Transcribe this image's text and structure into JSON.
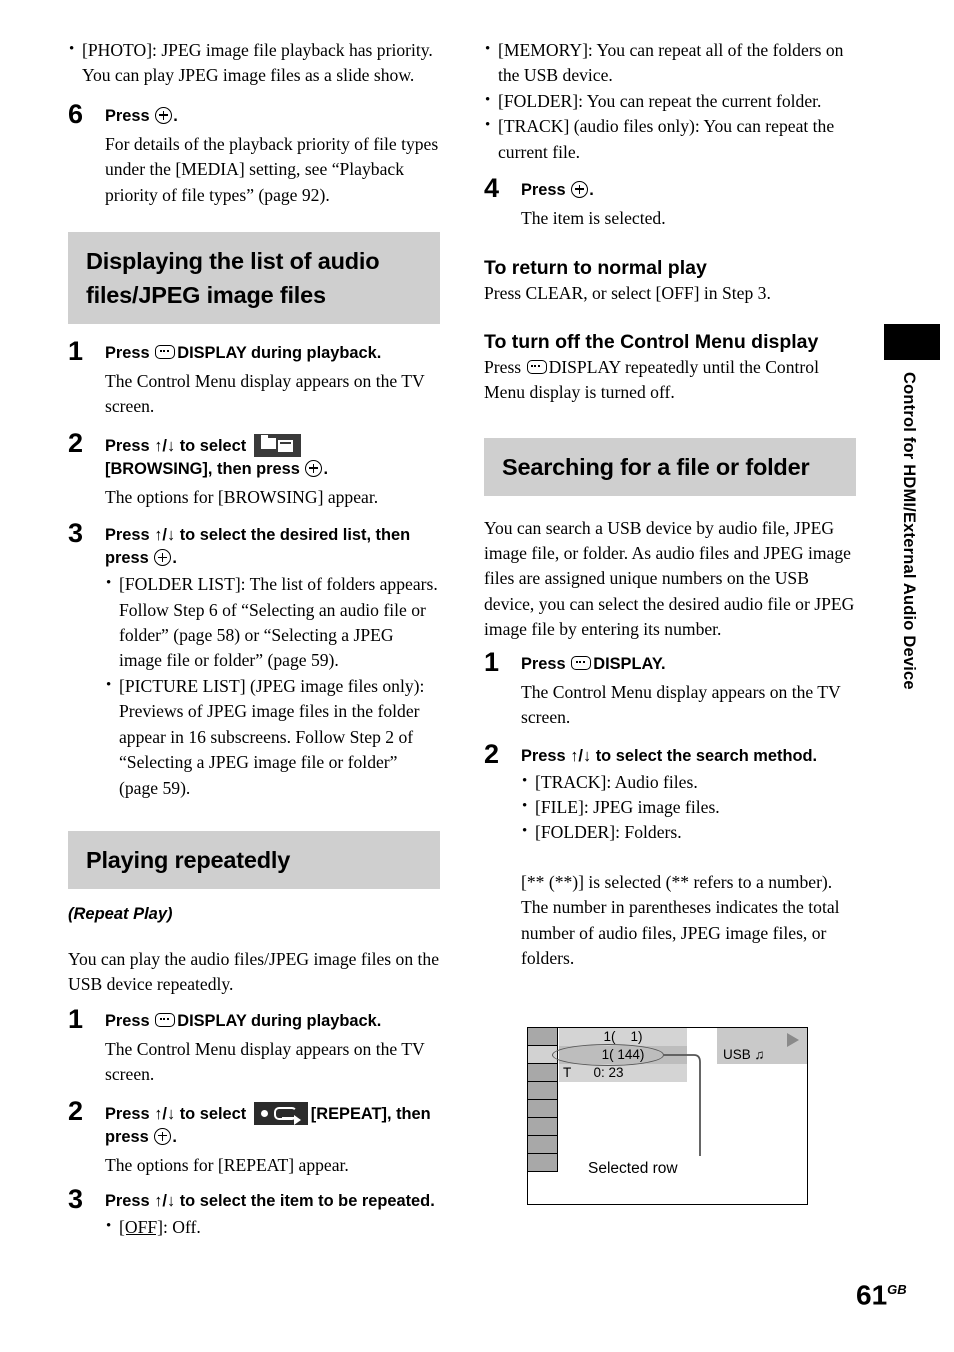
{
  "page": {
    "number": "61",
    "number_suffix": "GB",
    "side_tab_label": "Control for HDMI/External Audio Device"
  },
  "left_column": {
    "top_bullets": [
      "[PHOTO]: JPEG image file playback has priority. You can play JPEG image files as a slide show."
    ],
    "step6": {
      "num": "6",
      "title_pre": "Press",
      "title_post": ".",
      "body": "For details of the playback priority of file types under the [MEDIA] setting, see “Playback priority of file types” (page 92)."
    },
    "section1": {
      "heading": "Displaying the list of audio files/JPEG image files",
      "step1": {
        "num": "1",
        "title_pre": "Press",
        "title_post": "DISPLAY during playback.",
        "body": "The Control Menu display appears on the TV screen."
      },
      "step2": {
        "num": "2",
        "title_pre": "Press ↑/↓ to select",
        "title_mid": "[BROWSING], then press",
        "title_post": ".",
        "body": "The options for [BROWSING] appear."
      },
      "step3": {
        "num": "3",
        "title_pre": "Press ↑/↓ to select the desired list, then press",
        "title_post": ".",
        "bullets": [
          "[FOLDER LIST]: The list of folders appears. Follow Step 6 of “Selecting an audio file or folder” (page 58) or “Selecting a JPEG image file or folder” (page 59).",
          "[PICTURE LIST] (JPEG image files only): Previews of JPEG image files in the folder appear in 16 subscreens. Follow Step 2 of “Selecting a JPEG image file or folder” (page 59)."
        ]
      }
    },
    "section2": {
      "heading": "Playing repeatedly",
      "subtitle": "(Repeat Play)",
      "intro": "You can play the audio files/JPEG image files on the USB device repeatedly.",
      "step1": {
        "num": "1",
        "title_pre": "Press",
        "title_post": "DISPLAY during playback.",
        "body": "The Control Menu display appears on the TV screen."
      },
      "step2": {
        "num": "2",
        "title_pre": "Press ↑/↓ to select",
        "title_mid": "[REPEAT], then press",
        "title_post": ".",
        "body": "The options for [REPEAT] appear."
      },
      "step3": {
        "num": "3",
        "title": "Press ↑/↓ to select the item to be repeated.",
        "bullets_first": "[OFF]",
        "bullets_first_rest": ": Off."
      }
    }
  },
  "right_column": {
    "top_bullets": [
      "[MEMORY]: You can repeat all of the folders on the USB device.",
      "[FOLDER]: You can repeat the current folder.",
      "[TRACK] (audio files only): You can repeat the current file."
    ],
    "step4": {
      "num": "4",
      "title_pre": "Press",
      "title_post": ".",
      "body": "The item is selected."
    },
    "return_normal": {
      "heading": "To return to normal play",
      "body": "Press CLEAR, or select [OFF] in Step 3."
    },
    "turn_off": {
      "heading": "To turn off the Control Menu display",
      "body_pre": "Press",
      "body_post": "DISPLAY repeatedly until the Control Menu display is turned off."
    },
    "section3": {
      "heading": "Searching for a file or folder",
      "intro": "You can search a USB device by audio file, JPEG image file, or folder. As audio files and JPEG image files are assigned unique numbers on the USB device, you can select the desired audio file or JPEG image file by entering its number.",
      "step1": {
        "num": "1",
        "title_pre": "Press",
        "title_post": "DISPLAY.",
        "body": "The Control Menu display appears on the TV screen."
      },
      "step2": {
        "num": "2",
        "title": "Press ↑/↓ to select the search method.",
        "bullets": [
          "[TRACK]: Audio files.",
          "[FILE]: JPEG image files.",
          "[FOLDER]: Folders."
        ],
        "note": "[** (**)] is selected (** refers to a number). The number in parentheses indicates the total number of audio files, JPEG image files, or folders."
      }
    },
    "figure": {
      "row1": "1(    1)",
      "row2": "1( 144)",
      "row3": "T      0: 23",
      "usb_label": "USB",
      "usb_note_glyph": "♫",
      "caption": "Selected row"
    }
  },
  "colors": {
    "heading_band": "#cfcfcf",
    "icon_badge": "#2b2b2b",
    "figure_cell": "#a8a8a8",
    "figure_row": "#d4d4d4"
  }
}
